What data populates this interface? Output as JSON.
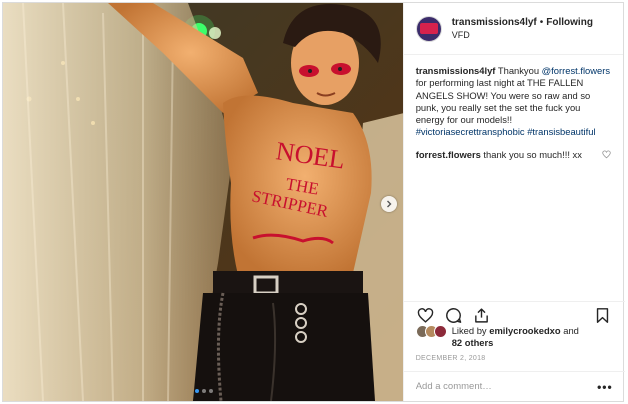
{
  "post": {
    "username": "transmissions4lyf",
    "separator": "•",
    "follow_status": "Following",
    "location": "VFD",
    "photo_text": {
      "line1": "NOEL",
      "line2": "THE",
      "line3": "STRIPPER"
    },
    "carousel": {
      "count": 3,
      "active_index": 0
    }
  },
  "caption": {
    "username": "transmissions4lyf",
    "text_before_mention": " Thankyou ",
    "mention": "@forrest.flowers",
    "text_after_mention": " for performing last night at THE FALLEN ANGELS SHOW! You were so raw and so punk, you really set the set the fuck you energy for our models!!",
    "hashtags": "#victoriasecrettransphobic #transisbeautiful"
  },
  "comments": [
    {
      "username": "forrest.flowers",
      "text": " thank you so much!!! xx"
    }
  ],
  "likes": {
    "prefix": "Liked by ",
    "user": "emilycrookedxo",
    "middle": " and",
    "others": "82 others"
  },
  "date": "DECEMBER 2, 2018",
  "add_comment": {
    "placeholder": "Add a comment…",
    "more": "•••"
  },
  "icons": {
    "like": "heart-icon",
    "comment": "comment-bubble-icon",
    "share": "share-icon",
    "save": "bookmark-icon",
    "next": "chevron-right-icon",
    "comment_like": "small-heart-icon"
  },
  "colors": {
    "link": "#003569",
    "carousel_active": "#3897f0",
    "lipstick": "#c8102e"
  }
}
